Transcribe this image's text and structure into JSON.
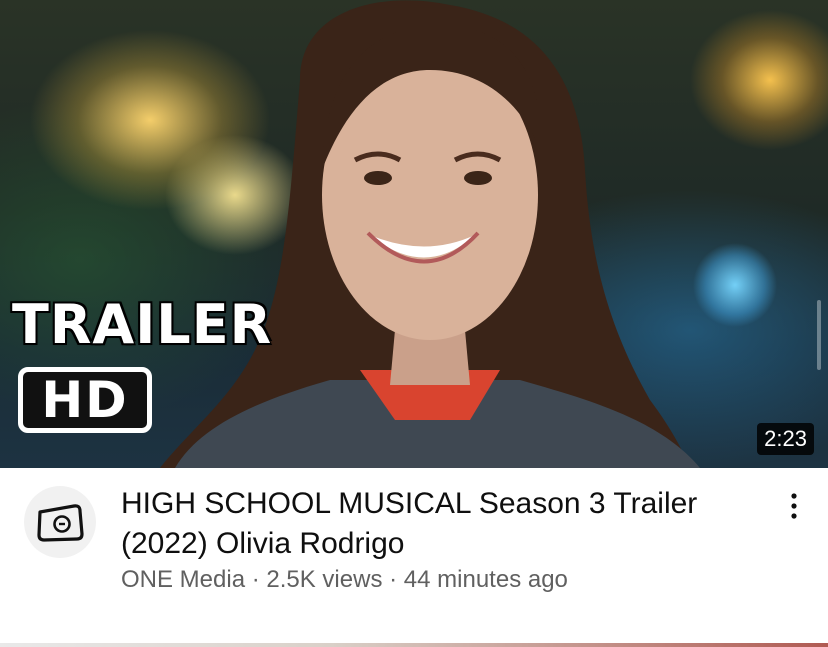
{
  "video": {
    "thumbnail": {
      "overlay_line1": "TRAILER",
      "overlay_line2": "HD",
      "duration": "2:23"
    },
    "title": "HIGH SCHOOL MUSICAL Season 3 Trailer (2022) Olivia Rodrigo",
    "channel": "ONE Media",
    "separator": "·",
    "views": "2.5K views",
    "uploaded": "44 minutes ago",
    "channel_avatar_icon": "one-media-logo-icon",
    "more_icon": "vertical-dots-icon"
  },
  "colors": {
    "title_text": "#0f0f0f",
    "meta_text": "#606060",
    "duration_badge_bg": "#000000",
    "page_bg": "#ffffff"
  }
}
